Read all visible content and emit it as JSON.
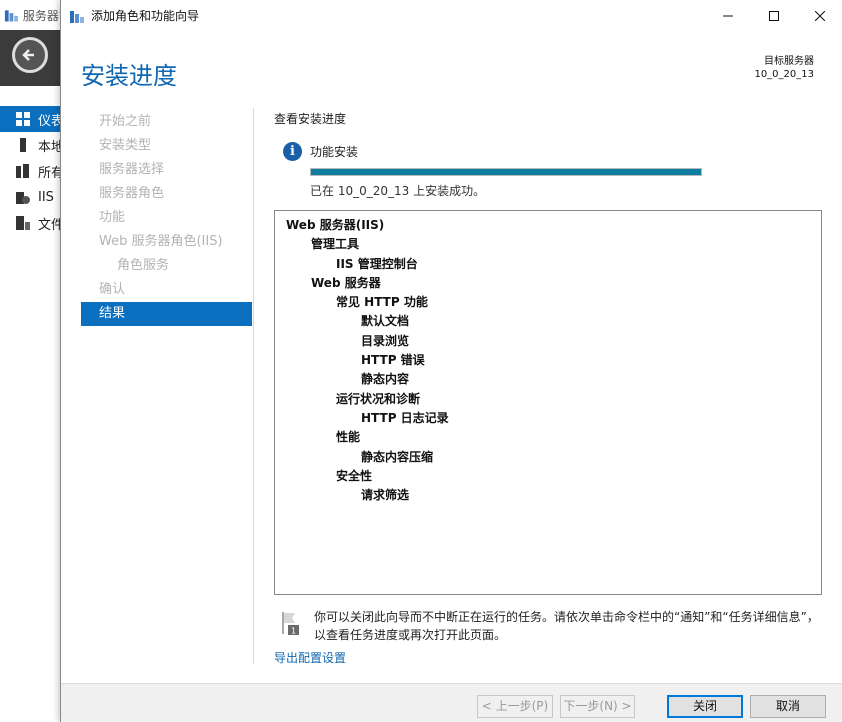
{
  "background_app": {
    "title": "服务器管理器",
    "nav_items": [
      {
        "label": "仪表板",
        "active": true
      },
      {
        "label": "本地服务器",
        "active": false
      },
      {
        "label": "所有服务器",
        "active": false
      },
      {
        "label": "IIS",
        "active": false
      },
      {
        "label": "文件和存储服务",
        "active": false
      }
    ]
  },
  "dialog": {
    "title": "添加角色和功能向导",
    "heading": "安装进度",
    "target_label": "目标服务器",
    "target_server": "10_0_20_13",
    "steps": [
      {
        "label": "开始之前",
        "sub": false,
        "active": false
      },
      {
        "label": "安装类型",
        "sub": false,
        "active": false
      },
      {
        "label": "服务器选择",
        "sub": false,
        "active": false
      },
      {
        "label": "服务器角色",
        "sub": false,
        "active": false
      },
      {
        "label": "功能",
        "sub": false,
        "active": false
      },
      {
        "label": "Web 服务器角色(IIS)",
        "sub": false,
        "active": false
      },
      {
        "label": "角色服务",
        "sub": true,
        "active": false
      },
      {
        "label": "确认",
        "sub": false,
        "active": false
      },
      {
        "label": "结果",
        "sub": false,
        "active": true
      }
    ],
    "section_title": "查看安装进度",
    "feature_install_label": "功能安装",
    "progress_fraction": 1.0,
    "status_text": "已在 10_0_20_13 上安装成功。",
    "results": [
      {
        "label": "Web 服务器(IIS)",
        "level": 0
      },
      {
        "label": "管理工具",
        "level": 1
      },
      {
        "label": "IIS 管理控制台",
        "level": 2
      },
      {
        "label": "Web 服务器",
        "level": 1
      },
      {
        "label": "常见 HTTP 功能",
        "level": 2
      },
      {
        "label": "默认文档",
        "level": 3
      },
      {
        "label": "目录浏览",
        "level": 3
      },
      {
        "label": "HTTP 错误",
        "level": 3
      },
      {
        "label": "静态内容",
        "level": 3
      },
      {
        "label": "运行状况和诊断",
        "level": 2
      },
      {
        "label": "HTTP 日志记录",
        "level": 3
      },
      {
        "label": "性能",
        "level": 2
      },
      {
        "label": "静态内容压缩",
        "level": 3
      },
      {
        "label": "安全性",
        "level": 2
      },
      {
        "label": "请求筛选",
        "level": 3
      }
    ],
    "notice_text": "你可以关闭此向导而不中断正在运行的任务。请依次单击命令栏中的“通知”和“任务详细信息”，以查看任务进度或再次打开此页面。",
    "export_link": "导出配置设置",
    "buttons": {
      "previous": "< 上一步(P)",
      "next": "下一步(N) >",
      "close": "关闭",
      "cancel": "取消"
    }
  },
  "colors": {
    "accent": "#0b6fbf",
    "heading": "#1167b1",
    "progress": "#0e7fa0"
  }
}
